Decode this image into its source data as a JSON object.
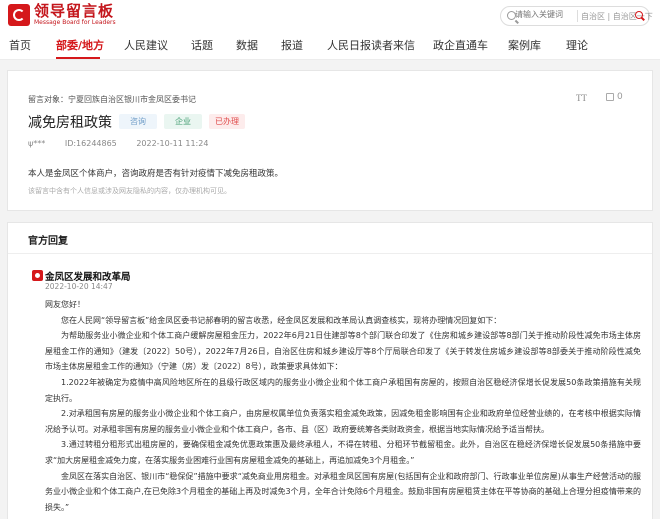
{
  "header": {
    "logo_text": "领导留言板",
    "logo_subtext": "Message Board for Leaders",
    "search_placeholder": "请输入关键词",
    "search_alt_text": "自治区 | 自治区一下"
  },
  "nav": {
    "items": [
      "首页",
      "部委/地方",
      "人民建议",
      "话题",
      "数据",
      "报道",
      "人民日报读者来信",
      "政企直通车",
      "案例库",
      "理论"
    ],
    "active_index": 1
  },
  "question": {
    "crumb": "留言对象：宁夏回族自治区银川市金凤区委书记",
    "font_icon": "TT",
    "like_count": "0",
    "title": "减免房租政策",
    "tags": [
      "咨询",
      "企业",
      "已办理"
    ],
    "author": "ψ***",
    "id_label": "ID:16244865",
    "time": "2022-10-11 11:24",
    "body": "本人是金凤区个体商户，咨询政府是否有针对疫情下减免房租政策。",
    "disclaimer": "该留言中含有个人信息或涉及网友隐私的内容，仅办理机构可见。"
  },
  "reply": {
    "heading": "官方回复",
    "org": "金凤区发展和改革局",
    "time": "2022-10-20 14:47",
    "paragraphs": [
      "网友您好！",
      "您在人民网“领导留言板”给金凤区委书记郝春明的留言收悉，经金凤区发展和改革局认真调查核实，现将办理情况回复如下：",
      "为帮助服务业小微企业和个体工商户缓解房屋租金压力，2022年6月21日住建部等8个部门联合印发了《住房和城乡建设部等8部门关于推动阶段性减免市场主体房屋租金工作的通知》（建发〔2022〕50号），2022年7月26日，自治区住房和城乡建设厅等8个厅局联合印发了《关于转发住房城乡建设部等8部委关于推动阶段性减免市场主体房屋租金工作的通知》（宁建（房）发〔2022〕8号），政策要求具体如下：",
      "1.2022年被确定为疫情中高风险地区所在的县级行政区域内的服务业小微企业和个体工商户承租国有房屋的，按照自治区稳经济保增长促发展50条政策措施有关规定执行。",
      "2.对承租国有房屋的服务业小微企业和个体工商户，由房屋权属单位负责落实租金减免政策，因减免租金影响国有企业和政府单位经营业绩的，在考核中根据实际情况给予认可。对承租非国有房屋的服务业小微企业和个体工商户，各市、县（区）政府要统筹各类财政资金，根据当地实际情况给予适当帮扶。",
      "3.通过转租分租形式出租房屋的，要确保租金减免优惠政策惠及最终承租人，不得在转租、分租环节截留租金。此外，自治区在稳经济保增长促发展50条措施中要求“加大房屋租金减免力度，在落实服务业困难行业国有房屋租金减免的基础上，再追加减免3个月租金。”",
      "金凤区在落实自治区、银川市“稳保促”措施中要求“减免商业用房租金。对承租金凤区国有房屋(包括国有企业和政府部门、行政事业单位房屋)从事生产经营活动的服务业小微企业和个体工商户,在已免除3个月租金的基础上再及时减免3个月，全年合计免除6个月租金。鼓励非国有房屋租赁主体在平等协商的基础上合理分担疫情带来的损失。”"
    ]
  }
}
